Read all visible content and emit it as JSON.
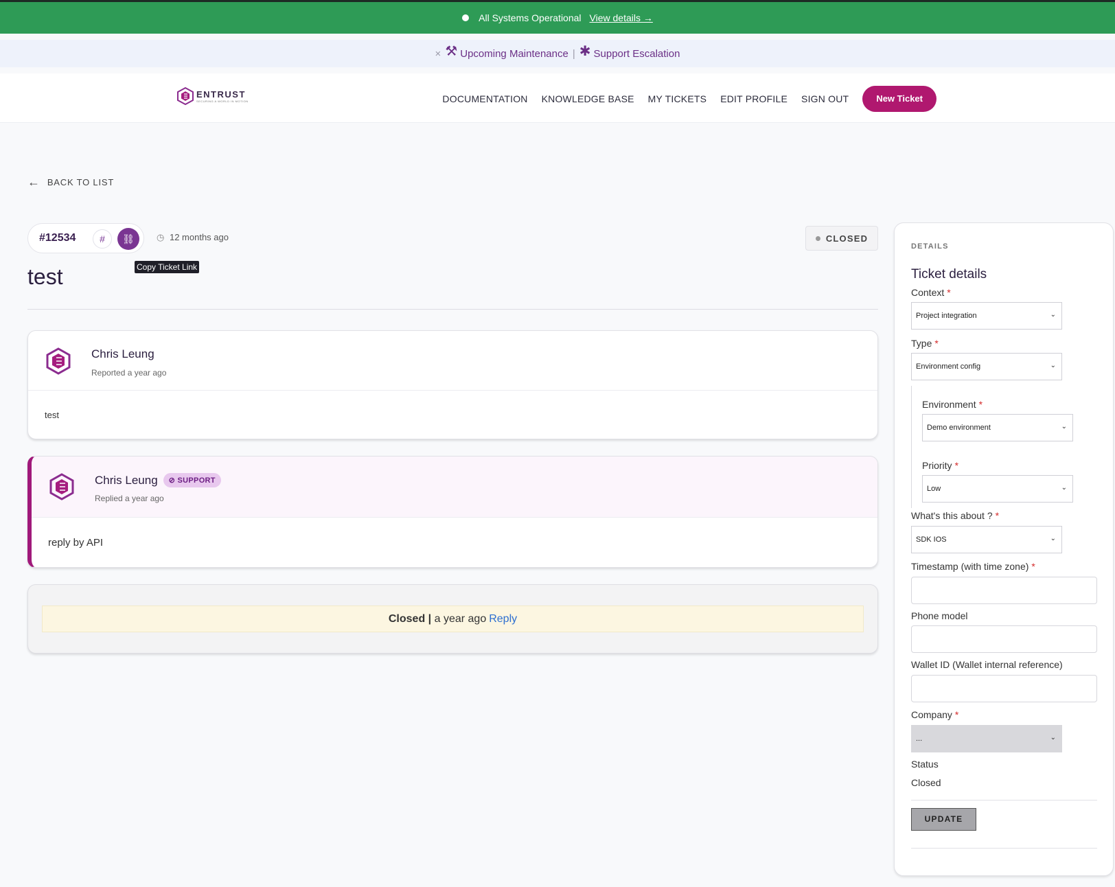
{
  "status_bar": {
    "text": "All Systems Operational",
    "link": "View details →"
  },
  "announcements": {
    "close": "×",
    "item1_icon": "⚒",
    "item1": "Upcoming Maintenance",
    "separator": "|",
    "item2_icon": "✱",
    "item2": "Support Escalation"
  },
  "header": {
    "logo_name": "ENTRUST",
    "logo_tagline": "SECURING A WORLD IN MOTION",
    "nav": [
      "DOCUMENTATION",
      "KNOWLEDGE BASE",
      "MY TICKETS",
      "EDIT PROFILE",
      "SIGN OUT"
    ],
    "new_ticket": "New Ticket"
  },
  "back": {
    "arrow": "←",
    "label": "BACK TO LIST"
  },
  "ticket": {
    "number": "#12534",
    "hash": "#",
    "link_icon": "⛓",
    "tooltip": "Copy Ticket Link",
    "clock_icon": "◷",
    "age": "12 months ago",
    "status_badge": "CLOSED",
    "title": "test"
  },
  "posts": [
    {
      "author": "Chris Leung",
      "meta": "Reported a year ago",
      "body": "test"
    },
    {
      "author": "Chris Leung",
      "badge": "⊘ SUPPORT",
      "meta": "Replied a year ago",
      "body": "reply by API"
    }
  ],
  "closed_notice": {
    "status": "Closed",
    "sep": "|",
    "when": "a year ago",
    "reply": "Reply"
  },
  "sidebar": {
    "eyebrow": "DETAILS",
    "title": "Ticket details",
    "required_mark": "*",
    "chevron": "⌄",
    "fields": {
      "context": {
        "label": "Context",
        "value": "Project integration"
      },
      "type": {
        "label": "Type",
        "value": "Environment config"
      },
      "environment": {
        "label": "Environment",
        "value": "Demo environment"
      },
      "priority": {
        "label": "Priority",
        "value": "Low"
      },
      "about": {
        "label": "What's this about ?",
        "value": "SDK IOS"
      },
      "timestamp": {
        "label": "Timestamp (with time zone)",
        "value": ""
      },
      "phone": {
        "label": "Phone model",
        "value": ""
      },
      "wallet": {
        "label": "Wallet ID (Wallet internal reference)",
        "value": ""
      },
      "company": {
        "label": "Company",
        "value": "..."
      }
    },
    "status_label": "Status",
    "status_value": "Closed",
    "update": "UPDATE"
  },
  "colors": {
    "status_green": "#2e9b56",
    "brand_magenta": "#b0186f",
    "brand_purple": "#7a3592",
    "support_accent": "#a0197a",
    "required": "#d42b2b",
    "link_blue": "#2d6fd0"
  }
}
